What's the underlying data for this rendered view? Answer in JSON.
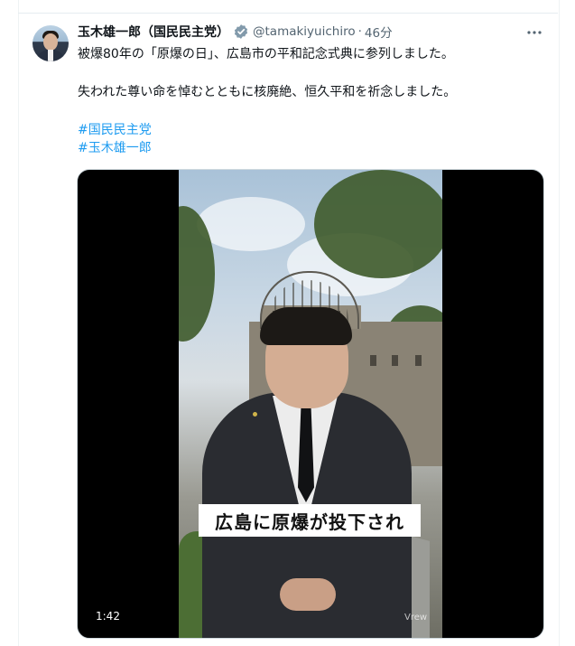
{
  "post": {
    "author": {
      "display_name": "玉木雄一郎（国民民主党）",
      "handle": "@tamakiyuichiro",
      "separator": "·",
      "time_ago": "46分",
      "verified": true
    },
    "more_icon": "more-horizontal-icon",
    "text_line1": "被爆80年の「原爆の日」、広島市の平和記念式典に参列しました。",
    "text_line2": "失われた尊い命を悼むとともに核廃絶、恒久平和を祈念しました。",
    "hashtags": [
      "#国民民主党",
      "#玉木雄一郎"
    ],
    "media": {
      "type": "video",
      "caption_overlay": "広島に原爆が投下され",
      "duration": "1:42",
      "watermark": "Vrew"
    }
  },
  "colors": {
    "link": "#1d9bf0",
    "secondary_text": "#536471",
    "verified_badge": "#829aab"
  }
}
